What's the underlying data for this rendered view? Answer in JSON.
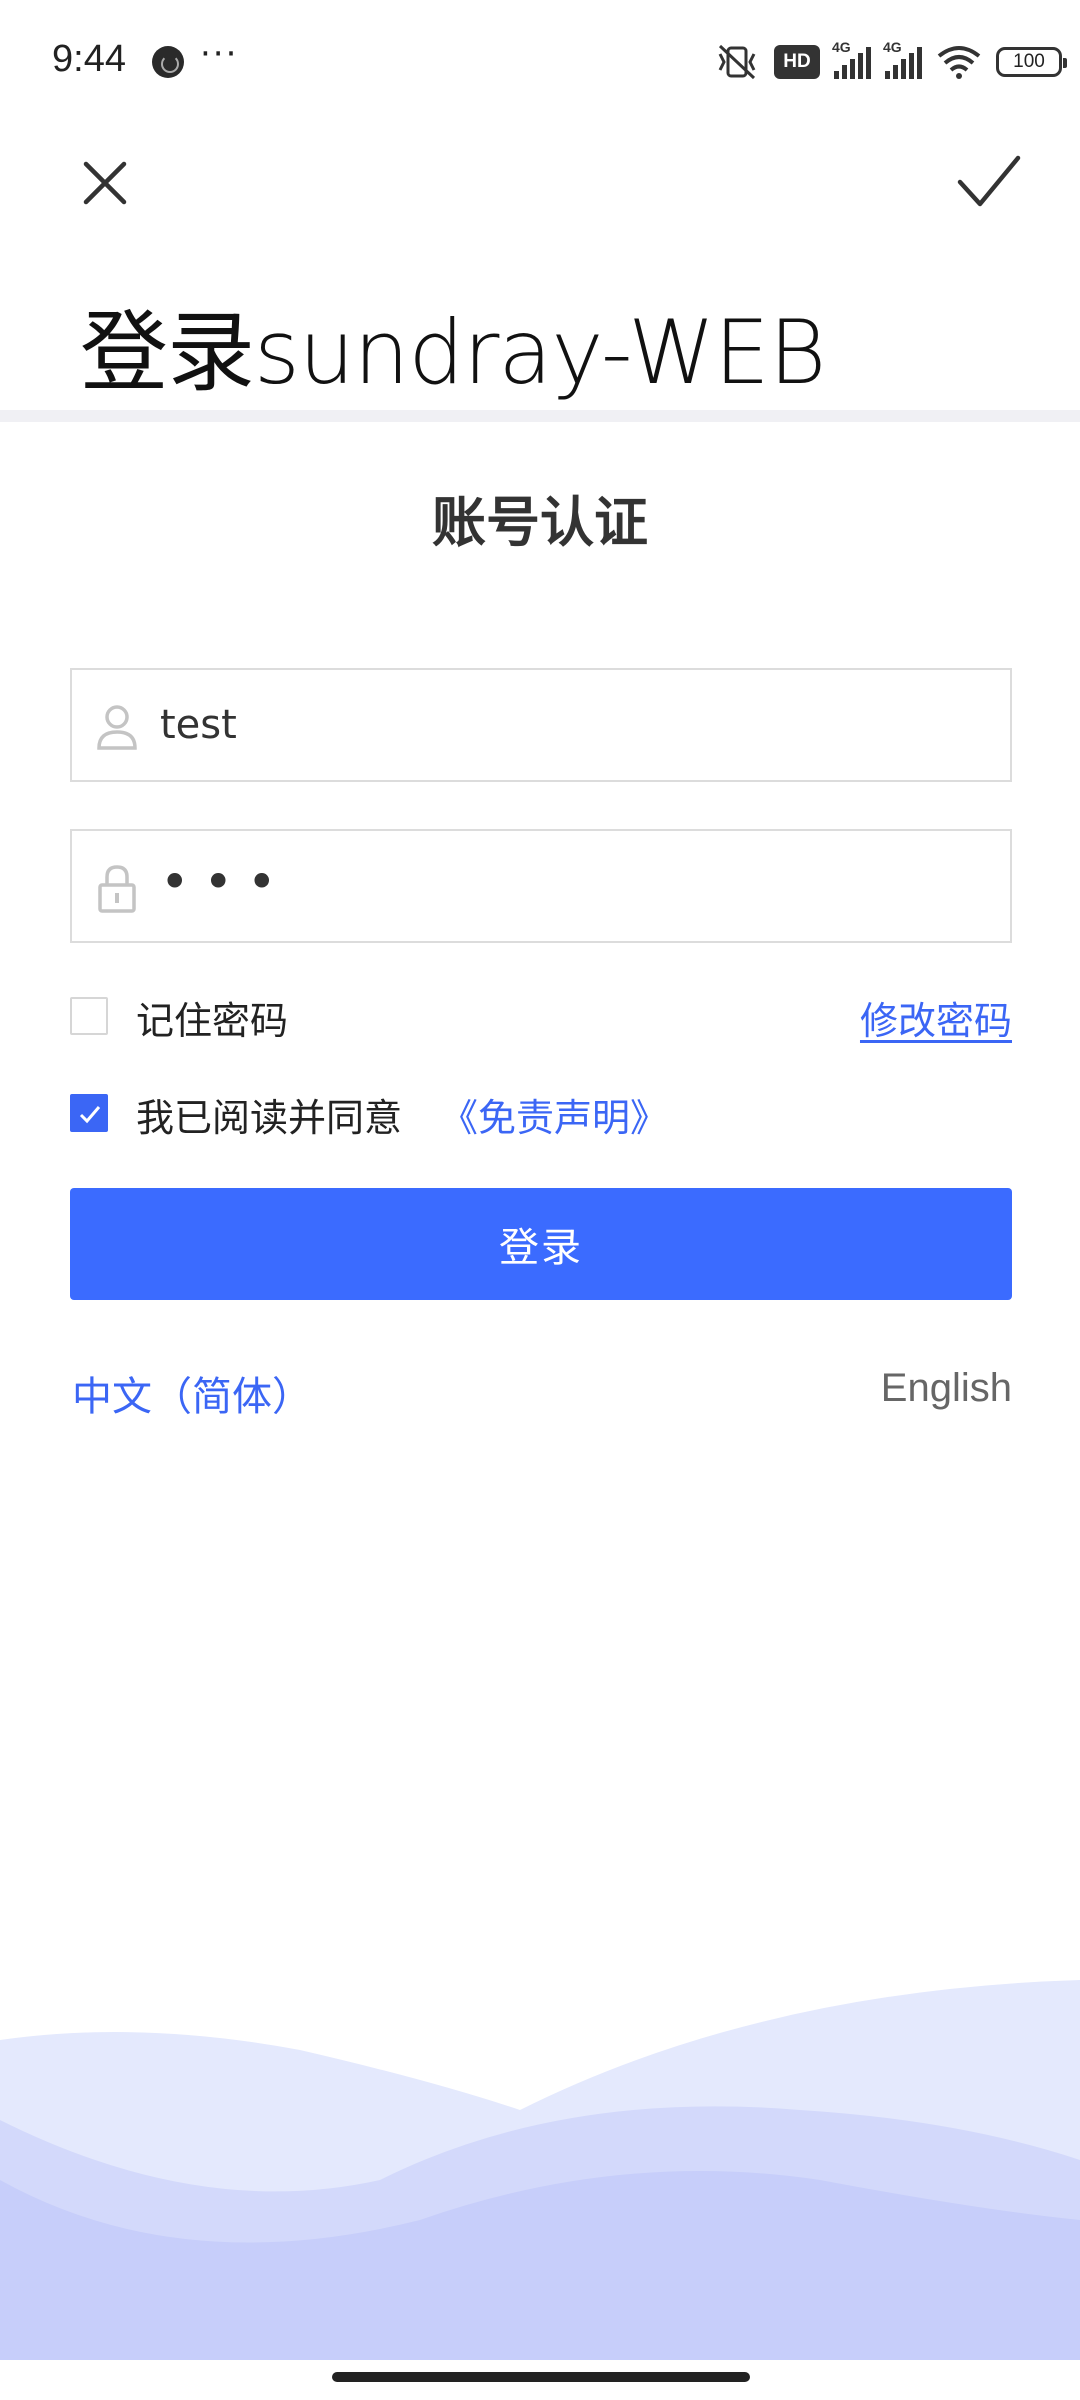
{
  "status_bar": {
    "time": "9:44",
    "more": "···",
    "hd_badge": "HD",
    "sim1_label": "4G",
    "sim2_label": "4G",
    "battery": "100",
    "icons": [
      "app-notification-icon",
      "mute-vibrate-icon",
      "hd-icon",
      "signal-icon",
      "signal-icon",
      "wifi-icon",
      "battery-icon"
    ]
  },
  "header": {
    "title": "登录sundray-WEB",
    "close_icon": "close-icon",
    "confirm_icon": "check-icon"
  },
  "form": {
    "heading": "账号认证",
    "username": "test",
    "password_mask": "•••",
    "remember_label": "记住密码",
    "change_password": "修改密码",
    "agree_label": "我已阅读并同意",
    "disclaimer_link": "《免责声明》",
    "agree_checked": true,
    "remember_checked": false,
    "login_label": "登录"
  },
  "languages": {
    "chinese": "中文（简体）",
    "english": "English"
  },
  "colors": {
    "accent": "#3b66f5",
    "button": "#3b6bff",
    "wave_light": "#e4e9fd",
    "wave_dark": "#c7cefa"
  }
}
